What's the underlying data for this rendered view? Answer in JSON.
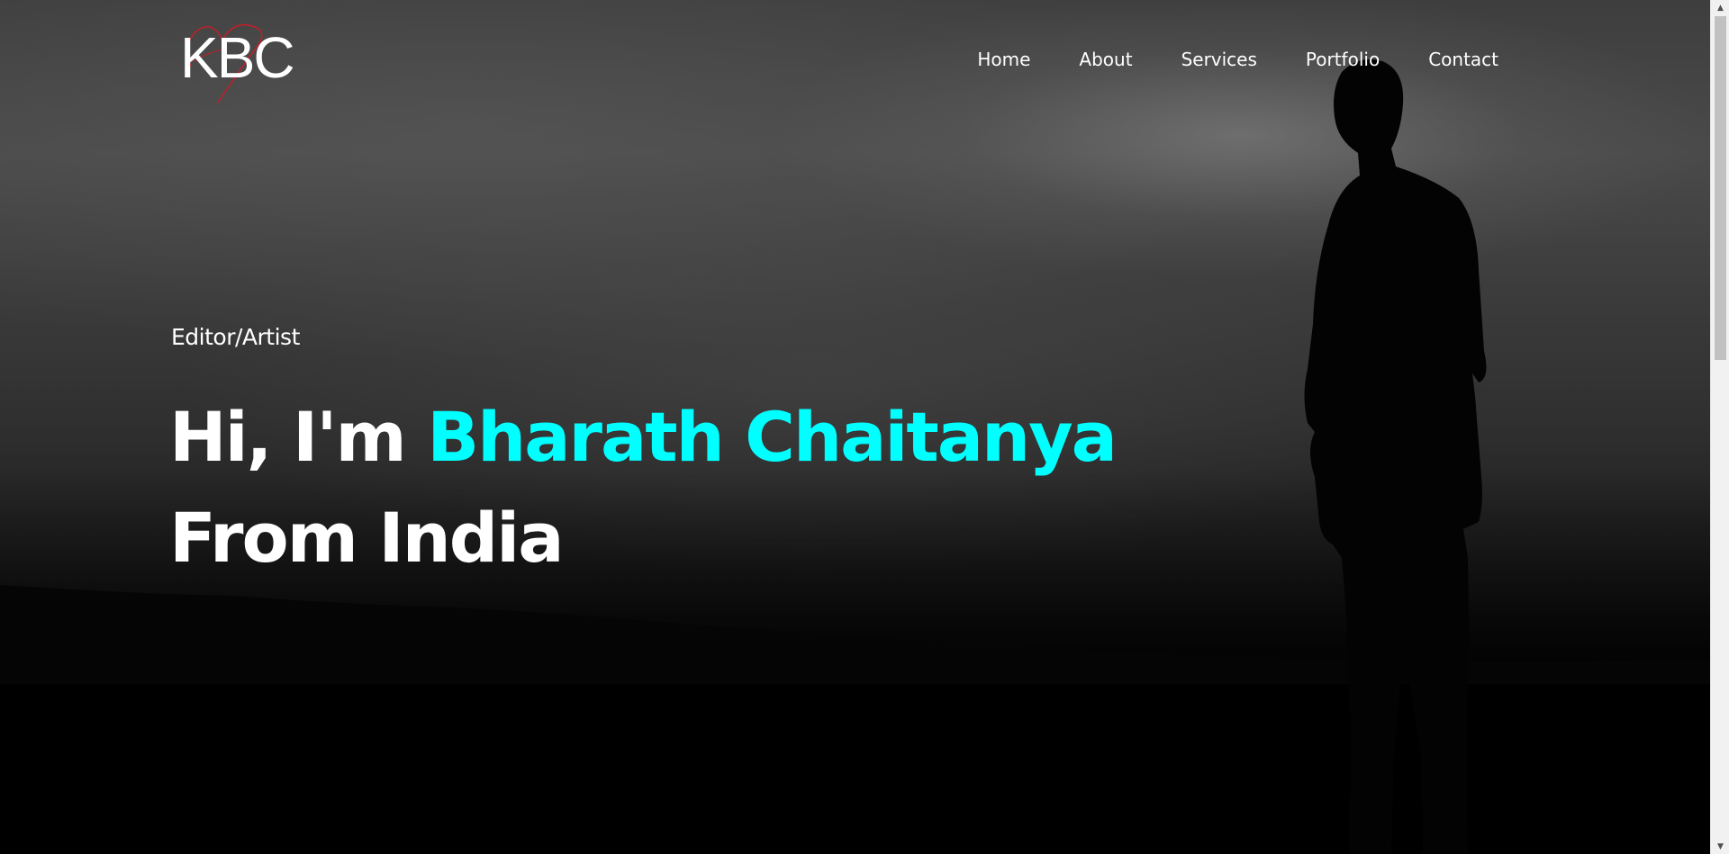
{
  "logo": {
    "text": "KBC",
    "scribble_color": "#c0202a"
  },
  "nav": {
    "items": [
      {
        "label": "Home"
      },
      {
        "label": "About"
      },
      {
        "label": "Services"
      },
      {
        "label": "Portfolio"
      },
      {
        "label": "Contact"
      }
    ]
  },
  "hero": {
    "subtitle": "Editor/Artist",
    "headline_prefix": "Hi, I'm",
    "headline_name": "Bharath Chaitanya",
    "headline_line2": "From India",
    "accent_color": "#00ffff"
  },
  "scrollbar": {
    "up_icon": "chevron-up-icon",
    "down_icon": "chevron-down-icon"
  }
}
